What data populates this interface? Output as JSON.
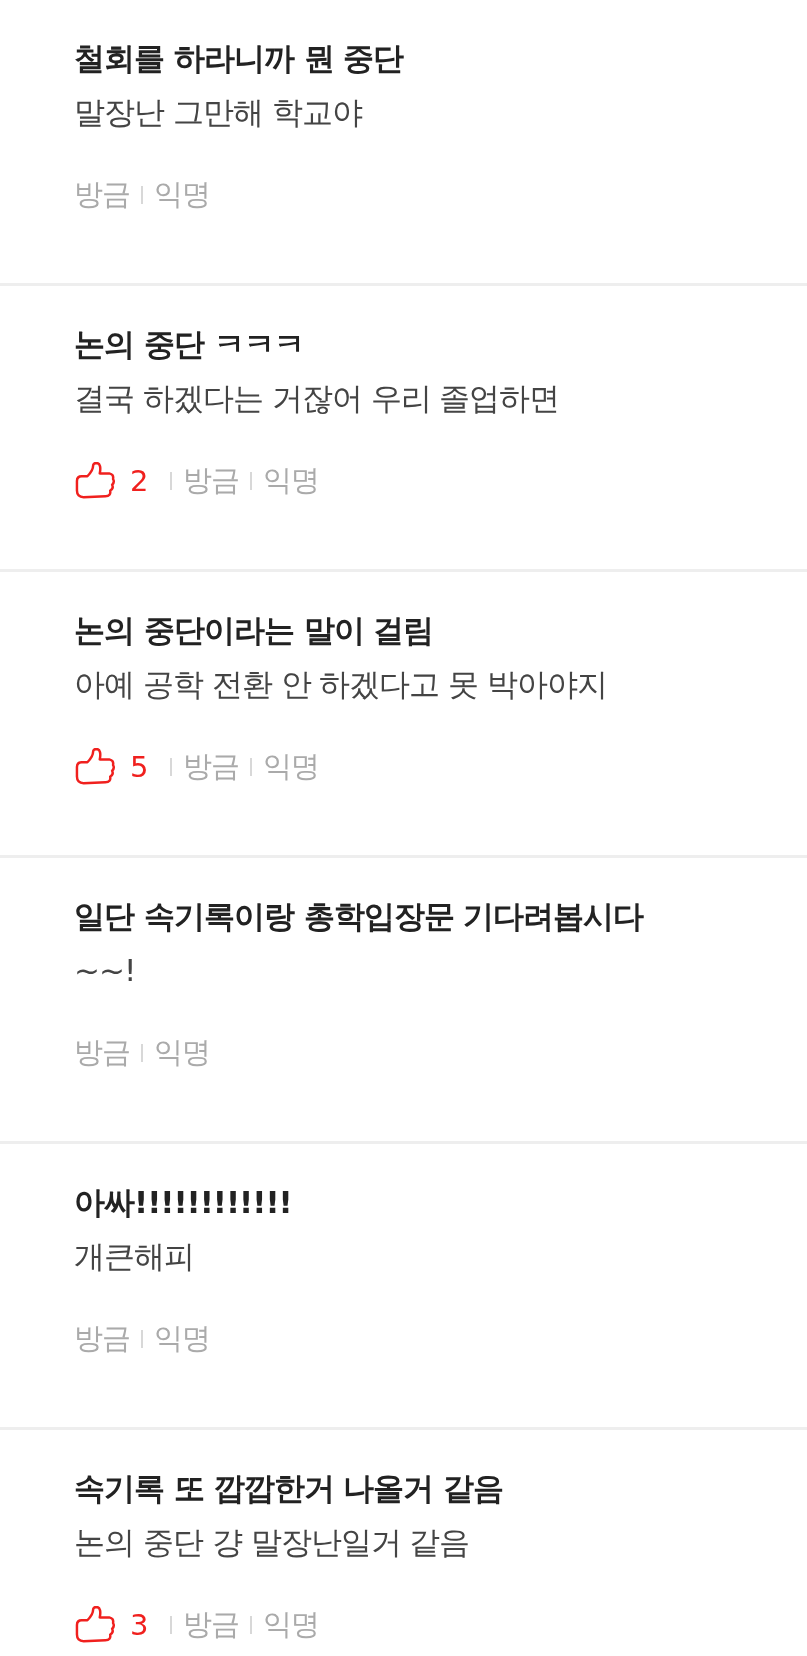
{
  "comments": [
    {
      "title": "철회를 하라니까 뭔 중단",
      "body": "말장난 그만해 학교야",
      "time": "방금",
      "author": "익명"
    },
    {
      "title": "논의 중단 ㅋㅋㅋ",
      "body": "결국 하겠다는 거잖어 우리 졸업하면",
      "likes": "2",
      "time": "방금",
      "author": "익명"
    },
    {
      "title": "논의 중단이라는 말이 걸림",
      "body": "아예 공학 전환 안 하겠다고 못 박아야지",
      "likes": "5",
      "time": "방금",
      "author": "익명"
    },
    {
      "title": "일단 속기록이랑 총학입장문 기다려봅시다",
      "body": "~~!",
      "time": "방금",
      "author": "익명"
    },
    {
      "title": "아싸!!!!!!!!!!!!",
      "body": "개큰해피",
      "time": "방금",
      "author": "익명"
    },
    {
      "title": "속기록 또 깝깝한거 나올거 같음",
      "body": "논의 중단 걍 말장난일거 같음",
      "likes": "3",
      "time": "방금",
      "author": "익명"
    }
  ]
}
